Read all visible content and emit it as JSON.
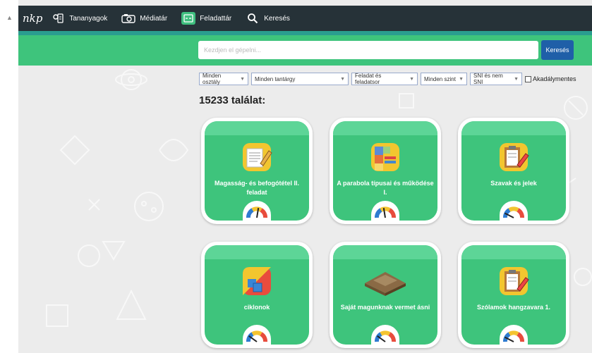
{
  "nav": {
    "logo": "nkp",
    "items": [
      {
        "label": "Tananyagok",
        "icon": "course-icon",
        "active": false
      },
      {
        "label": "Médiatár",
        "icon": "camera-icon",
        "active": false
      },
      {
        "label": "Feladattár",
        "icon": "task-icon",
        "active": true
      },
      {
        "label": "Keresés",
        "icon": "search-icon",
        "active": false
      }
    ]
  },
  "search": {
    "placeholder": "Kezdjen el gépelni...",
    "button_label": "Keresés"
  },
  "filters": [
    "Minden osztály",
    "Minden tantárgy",
    "Feladat és feladatsor",
    "Minden szint",
    "SNI és nem SNI"
  ],
  "accessible_label": "Akadálymentes",
  "result_count": "15233 találat:",
  "cards": [
    {
      "title": "Magasság- és befogótétel II. feladat",
      "icon": "document-pencil-icon",
      "gauge": 0.55
    },
    {
      "title": "A parabola típusai és működése I.",
      "icon": "abc-blocks-icon",
      "gauge": 0.45
    },
    {
      "title": "Szavak és jelek",
      "icon": "clipboard-pencil-icon",
      "gauge": 0.15
    },
    {
      "title": "ciklonok",
      "icon": "shapes-icon",
      "gauge": 0.2
    },
    {
      "title": "Saját magunknak vermet ásni",
      "icon": "hut-icon",
      "gauge": 0.2
    },
    {
      "title": "Szólamok hangzavara 1.",
      "icon": "clipboard-pencil-icon",
      "gauge": 0.15
    }
  ],
  "colors": {
    "topbar": "#263238",
    "green": "#3ec47c",
    "green_light": "#5dd597",
    "button_blue": "#1f5fa8"
  }
}
